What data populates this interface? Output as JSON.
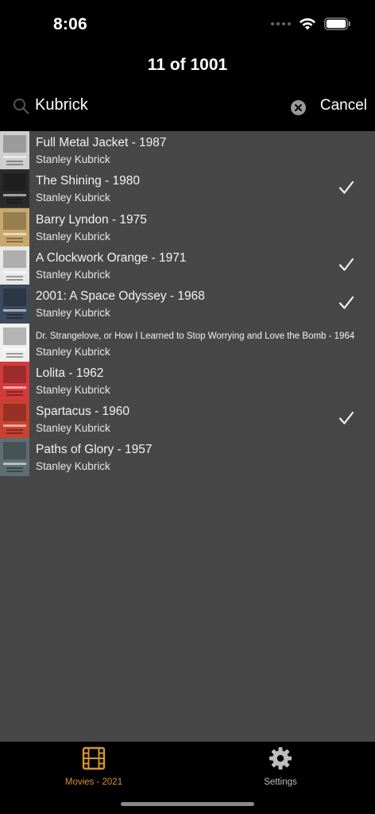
{
  "status": {
    "time": "8:06"
  },
  "nav": {
    "title": "11 of 1001"
  },
  "search": {
    "value": "Kubrick",
    "cancel_label": "Cancel"
  },
  "movies": [
    {
      "title": "Full Metal Jacket - 1987",
      "director": "Stanley Kubrick",
      "checked": false,
      "poster_color": "#cfcfcf"
    },
    {
      "title": "The Shining - 1980",
      "director": "Stanley Kubrick",
      "checked": true,
      "poster_color": "#2a2a2a"
    },
    {
      "title": "Barry Lyndon - 1975",
      "director": "Stanley Kubrick",
      "checked": false,
      "poster_color": "#c9a86b"
    },
    {
      "title": "A Clockwork Orange - 1971",
      "director": "Stanley Kubrick",
      "checked": true,
      "poster_color": "#e8e8e8"
    },
    {
      "title": "2001: A Space Odyssey - 1968",
      "director": "Stanley Kubrick",
      "checked": true,
      "poster_color": "#3b4a5c"
    },
    {
      "title": "Dr. Strangelove, or How I Learned to Stop Worrying and Love the Bomb - 1964",
      "director": "Stanley Kubrick",
      "checked": false,
      "poster_color": "#f0f0f0"
    },
    {
      "title": "Lolita - 1962",
      "director": "Stanley Kubrick",
      "checked": false,
      "poster_color": "#d33a3a"
    },
    {
      "title": "Spartacus - 1960",
      "director": "Stanley Kubrick",
      "checked": true,
      "poster_color": "#c8432f"
    },
    {
      "title": "Paths of Glory - 1957",
      "director": "Stanley Kubrick",
      "checked": false,
      "poster_color": "#5d6f73"
    }
  ],
  "tabs": [
    {
      "label": "Movies - 2021",
      "icon": "film-icon",
      "active": true
    },
    {
      "label": "Settings",
      "icon": "gear-icon",
      "active": false
    }
  ],
  "colors": {
    "accent": "#d4952f",
    "list_bg": "#474747",
    "inactive_tab": "#bdbdbd"
  }
}
